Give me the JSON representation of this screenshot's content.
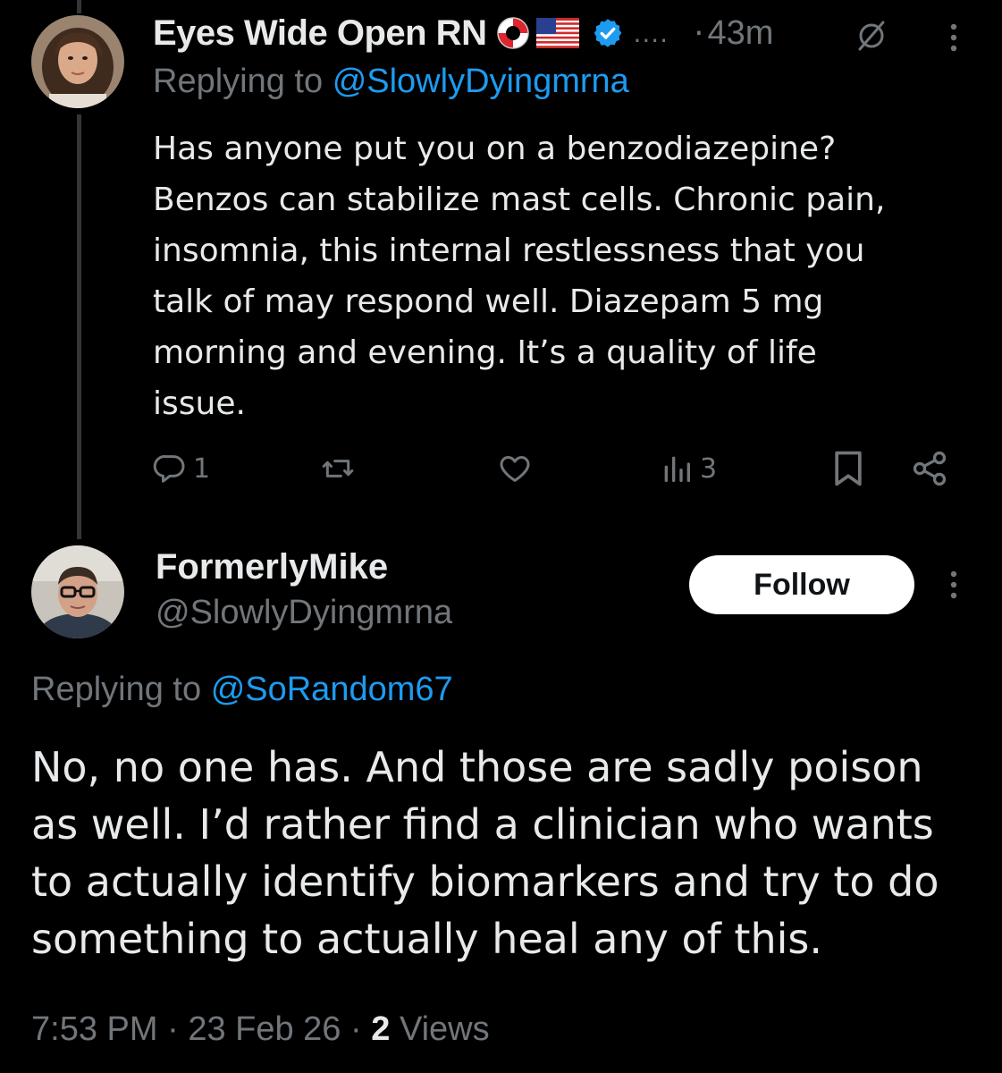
{
  "colors": {
    "background": "#000000",
    "text_primary": "#e7e9ea",
    "text_secondary": "#71767b",
    "accent_blue": "#1d9bf0",
    "follow_button_bg": "#ffffff"
  },
  "tweet1": {
    "author_name": "Eyes Wide Open RN",
    "name_emojis": [
      "lifebuoy-emoji",
      "us-flag-emoji"
    ],
    "verified_icon": "verified-badge-icon",
    "truncation": "....",
    "time_separator": "·",
    "time_ago": "43m",
    "grok_icon": "grok-icon",
    "more_icon": "more-vertical-icon",
    "replying_label": "Replying to",
    "replying_to": "@SlowlyDyingmrna",
    "body_lines": [
      "Has anyone put you on a benzodiazepine?",
      "Benzos can stabilize mast cells. Chronic pain,",
      "insomnia, this internal restlessness that you",
      "talk of may respond well. Diazepam 5 mg",
      "morning and evening. It’s a quality of life",
      "issue."
    ],
    "actions": {
      "reply_count": "1",
      "retweet_count": "",
      "like_count": "",
      "views_count": "3"
    }
  },
  "tweet2": {
    "author_name": "FormerlyMike",
    "handle": "@SlowlyDyingmrna",
    "follow_label": "Follow",
    "more_icon": "more-vertical-icon",
    "replying_label": "Replying to",
    "replying_to": "@SoRandom67",
    "body_lines": [
      "No, no one has. And those are sadly poison",
      "as well. I’d rather find a clinician who wants",
      "to actually identify biomarkers and try to do",
      "something to actually heal any of this."
    ],
    "time": "7:53 PM",
    "separator": "·",
    "date": "23 Feb 26",
    "views_count": "2",
    "views_label": "Views"
  }
}
